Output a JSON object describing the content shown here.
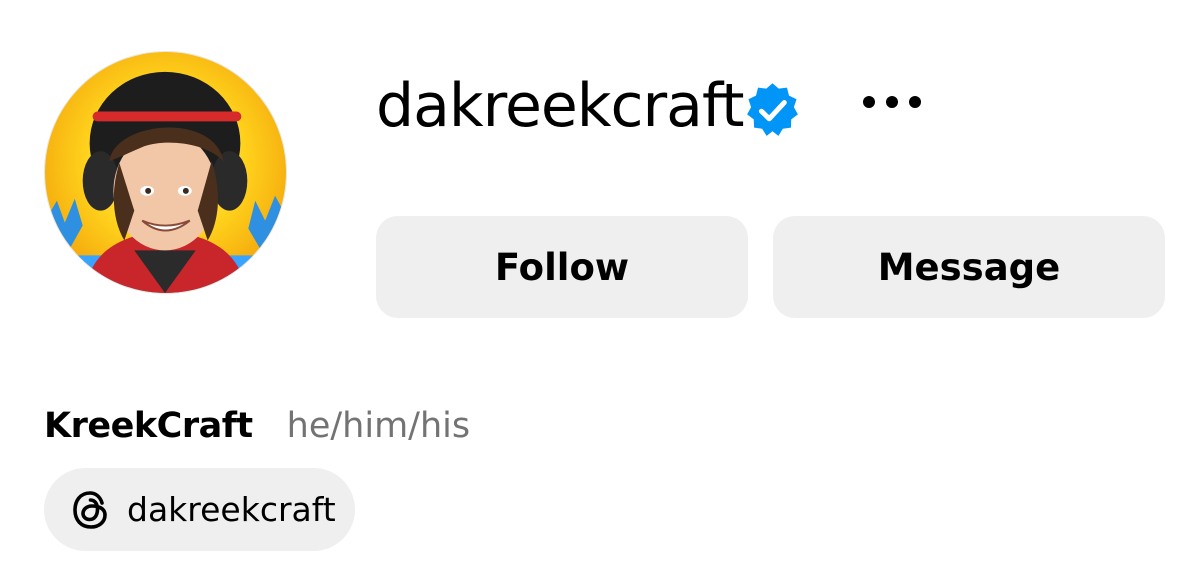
{
  "profile": {
    "username": "dakreekcraft",
    "display_name": "KreekCraft",
    "pronouns": "he/him/his",
    "verified": true
  },
  "actions": {
    "follow_label": "Follow",
    "message_label": "Message"
  },
  "threads": {
    "handle": "dakreekcraft"
  },
  "icons": {
    "verified": "verified-badge-icon",
    "more": "more-options-icon",
    "threads": "threads-icon"
  },
  "colors": {
    "button_bg": "#efefef",
    "verified_blue": "#0095f6",
    "secondary_text": "#737373"
  }
}
